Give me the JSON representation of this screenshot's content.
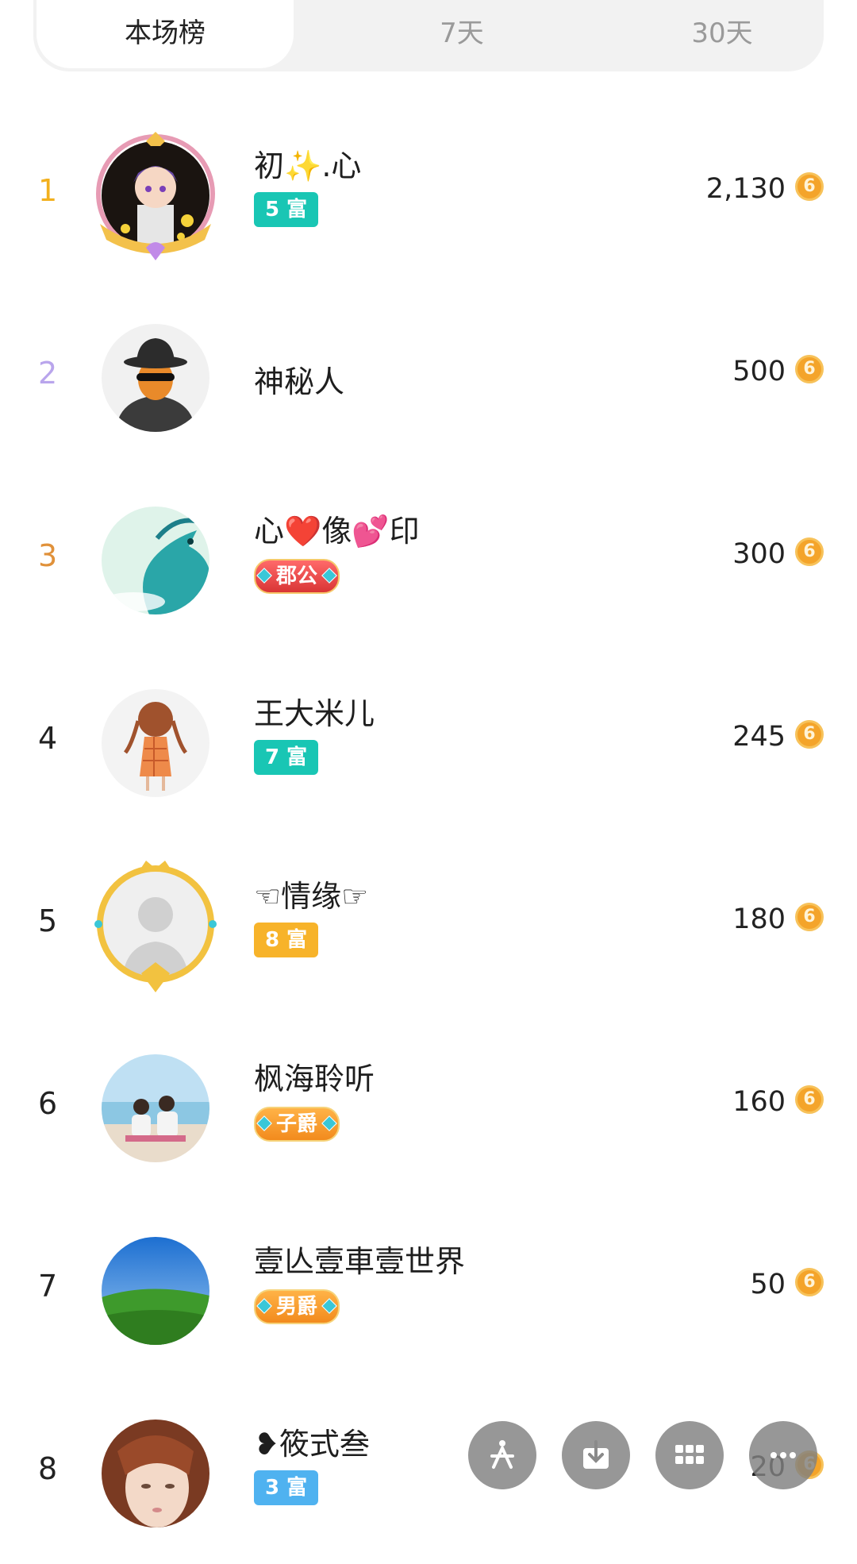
{
  "tabs": [
    {
      "label": "本场榜",
      "active": true
    },
    {
      "label": "7天",
      "active": false
    },
    {
      "label": "30天",
      "active": false
    }
  ],
  "currency_icon": "gold-coin-icon",
  "rows": [
    {
      "rank": "1",
      "rank_color": "#f2b01e",
      "name": "初✨.心",
      "badge": "5 富",
      "score": "2,130",
      "avatar": "anime-boy-avatar"
    },
    {
      "rank": "2",
      "rank_color": "#b9a5ec",
      "name": "神秘人",
      "badge": "",
      "score": "500",
      "avatar": "mystery-man-avatar"
    },
    {
      "rank": "3",
      "rank_color": "#e0913a",
      "name": "心❤️像💕印",
      "badge": "郡公",
      "score": "300",
      "avatar": "dragon-avatar"
    },
    {
      "rank": "4",
      "rank_color": "#222222",
      "name": "王大米儿",
      "badge": "7 富",
      "score": "245",
      "avatar": "girl-braids-avatar"
    },
    {
      "rank": "5",
      "rank_color": "#222222",
      "name": "☜情缘☞",
      "badge": "8 富",
      "score": "180",
      "avatar": "default-user-avatar"
    },
    {
      "rank": "6",
      "rank_color": "#222222",
      "name": "枫海聆听",
      "badge": "子爵",
      "score": "160",
      "avatar": "beach-couple-avatar"
    },
    {
      "rank": "7",
      "rank_color": "#222222",
      "name": "壹亾壹車壹世界",
      "badge": "男爵",
      "score": "50",
      "avatar": "green-field-avatar"
    },
    {
      "rank": "8",
      "rank_color": "#222222",
      "name": "❥筱式叁",
      "badge": "3 富",
      "score": "20",
      "avatar": "doll-avatar"
    }
  ],
  "fab_icons": [
    "sparkle-icon",
    "download-icon",
    "grid-icon",
    "more-icon"
  ]
}
